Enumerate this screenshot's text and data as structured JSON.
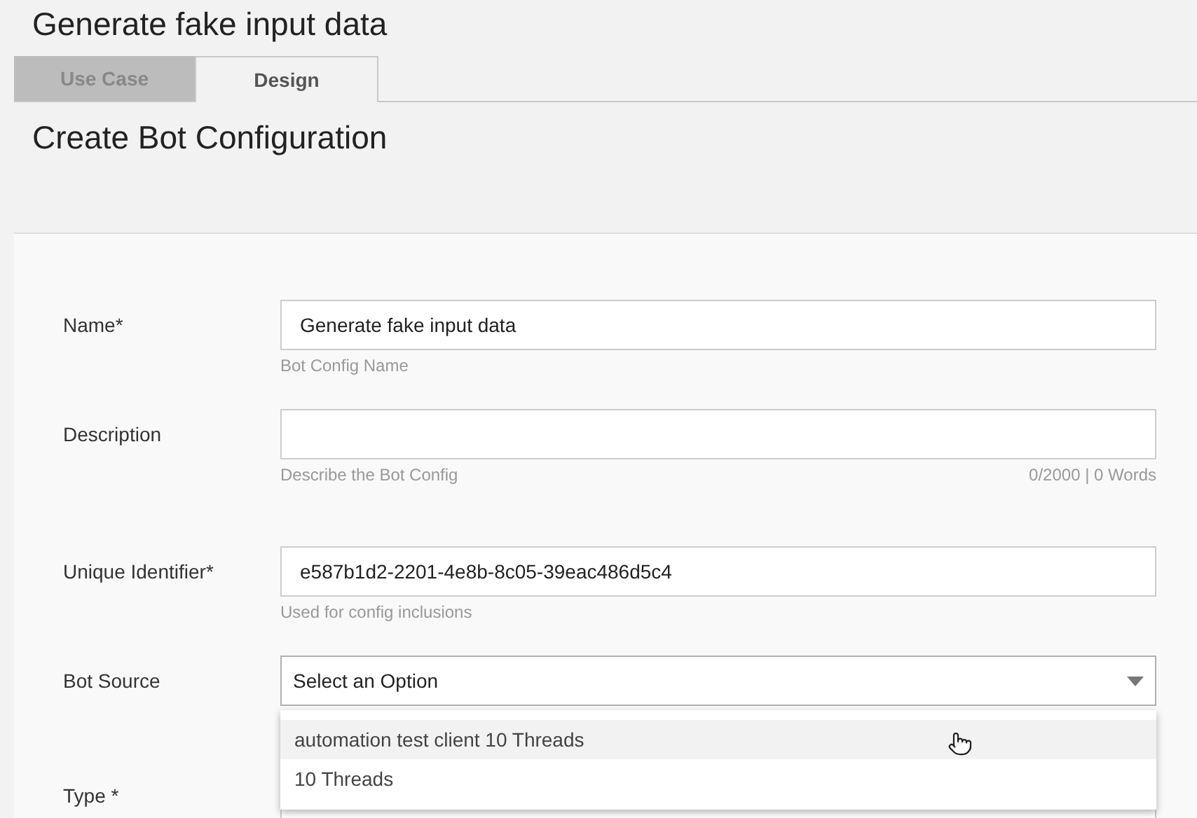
{
  "page": {
    "title": "Generate fake input data"
  },
  "tabs": [
    {
      "label": "Use Case",
      "selected": false
    },
    {
      "label": "Design",
      "selected": true
    }
  ],
  "section": {
    "title": "Create Bot Configuration"
  },
  "fields": [
    {
      "kind": "text",
      "label": "Name*",
      "value": "Generate fake input data",
      "hint": "Bot Config Name"
    },
    {
      "kind": "text",
      "label": "Description",
      "hint": "Describe the Bot Config",
      "counter": "0/2000 | 0 Words"
    },
    {
      "kind": "text",
      "label": "Unique Identifier*",
      "value": "e587b1d2-2201-4e8b-8c05-39eac486d5c4",
      "hint": "Used for config inclusions"
    },
    {
      "kind": "select",
      "label": "Bot Source",
      "value": "Select an Option",
      "expanded": true,
      "options": [
        {
          "label": "automation test client 10 Threads",
          "highlighted": true
        },
        {
          "label": "10 Threads",
          "highlighted": false
        }
      ]
    },
    {
      "kind": "text",
      "label": "Type *"
    }
  ]
}
